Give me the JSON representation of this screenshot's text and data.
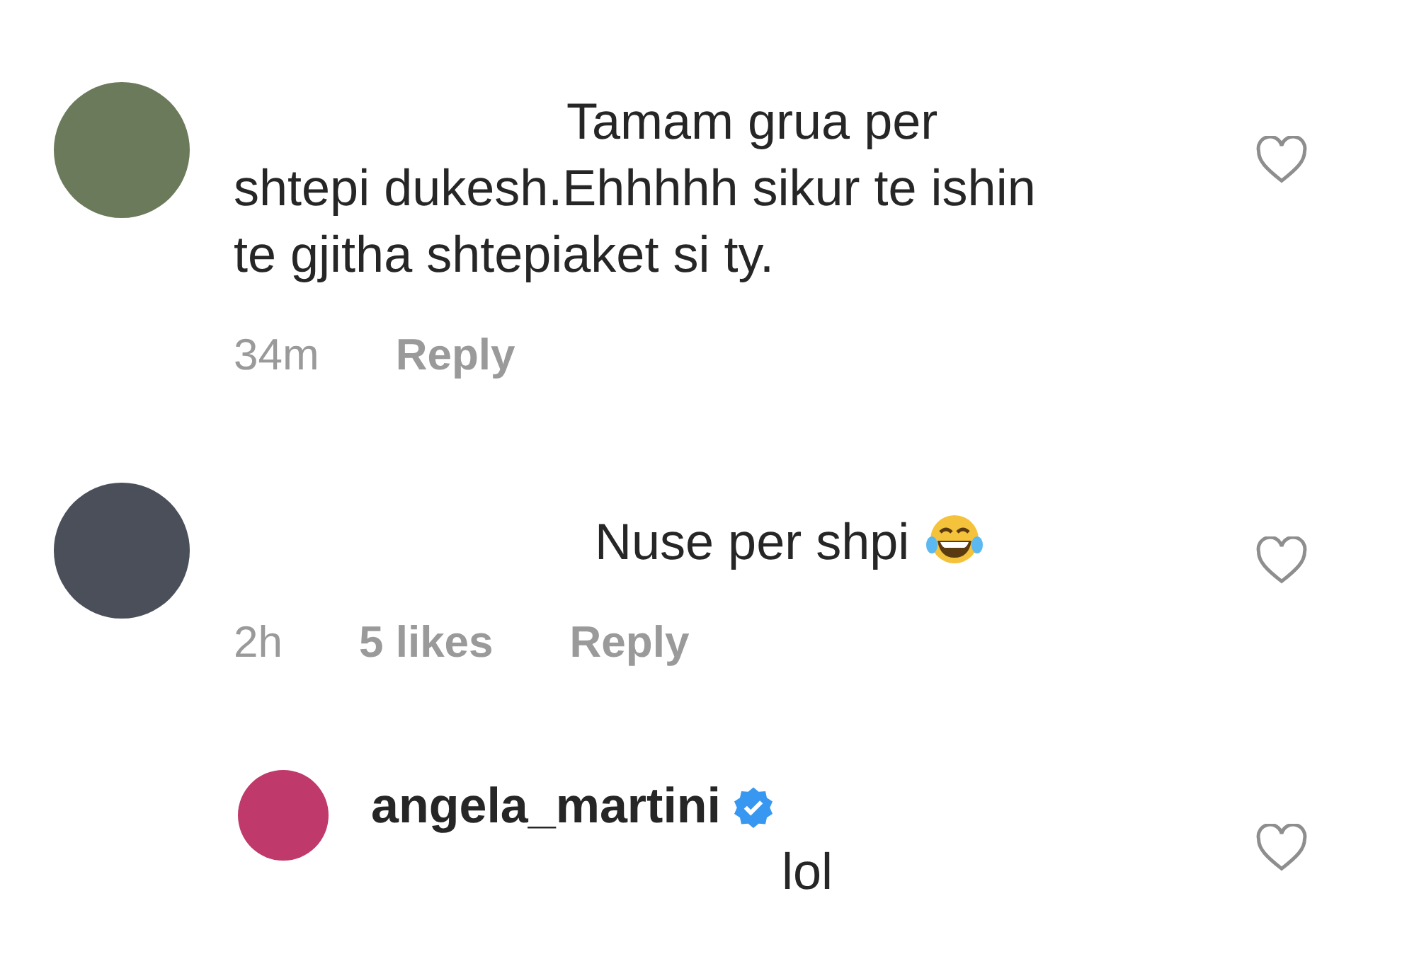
{
  "comments": [
    {
      "kind": "comment",
      "text": "Tamam grua per shtepi dukesh.Ehhhhh sikur te ishin te gjitha shtepiaket si ty.",
      "emoji": false,
      "time": "34m",
      "reply": "Reply",
      "liked": false
    },
    {
      "kind": "comment",
      "text": "Nuse per shpi",
      "emoji": true,
      "time": "2h",
      "likes": "5 likes",
      "reply": "Reply",
      "liked": false
    },
    {
      "kind": "reply",
      "username": "angela_martini",
      "verified": true,
      "text": "lol",
      "emoji": false,
      "liked": false
    }
  ]
}
